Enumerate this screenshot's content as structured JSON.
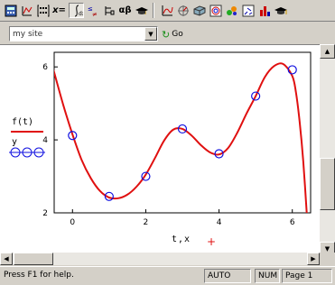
{
  "toolbar": {
    "icons": [
      "calculator-toolbar-icon",
      "graph-toolbar-icon",
      "matrix-toolbar-icon",
      "evaluation-toolbar-icon",
      "calculus-toolbar-icon",
      "boolean-toolbar-icon",
      "programming-toolbar-icon",
      "greek-toolbar-icon",
      "symbolic-toolbar-icon",
      "xy-plot-icon",
      "polar-plot-icon",
      "surface-plot-icon",
      "contour-plot-icon",
      "scatter-3d-icon",
      "vector-field-icon",
      "bar-3d-icon",
      "resources-icon"
    ],
    "eval_label": "x=",
    "greek_label": "αβ"
  },
  "urlbar": {
    "value": "my site",
    "go_label": "Go"
  },
  "legend": {
    "curve_label": "f(t)",
    "points_label": "y",
    "curve_color": "#e01010",
    "points_color": "#1010e0"
  },
  "chart_data": {
    "type": "line",
    "xlabel": "t,x",
    "xlim": [
      -0.5,
      6.5
    ],
    "ylim": [
      2,
      6.4
    ],
    "x_ticks": [
      0,
      2,
      4,
      6
    ],
    "y_ticks": [
      2,
      4,
      6
    ],
    "series": [
      {
        "name": "f(t)",
        "style": "line",
        "color": "#e01010",
        "x": [
          -0.65,
          -0.5,
          -0.25,
          0,
          0.25,
          0.5,
          0.75,
          1,
          1.25,
          1.5,
          1.75,
          2,
          2.25,
          2.5,
          2.75,
          3,
          3.25,
          3.5,
          3.75,
          4,
          4.25,
          4.5,
          4.75,
          5,
          5.25,
          5.5,
          5.75,
          6,
          6.1,
          6.2,
          6.3,
          6.4
        ],
        "y": [
          6.4,
          5.85,
          4.95,
          4.15,
          3.45,
          2.95,
          2.6,
          2.42,
          2.4,
          2.5,
          2.72,
          3.05,
          3.5,
          3.98,
          4.28,
          4.3,
          4.12,
          3.86,
          3.66,
          3.6,
          3.78,
          4.2,
          4.72,
          5.2,
          5.72,
          6.02,
          6.08,
          5.75,
          5.3,
          4.5,
          3.4,
          1.9
        ]
      },
      {
        "name": "y",
        "style": "points",
        "color": "#1010e0",
        "x": [
          0,
          1,
          2,
          3,
          4,
          5,
          6
        ],
        "y": [
          4.12,
          2.45,
          3.0,
          4.3,
          3.62,
          5.2,
          5.92
        ]
      }
    ]
  },
  "status": {
    "help_text": "Press F1 for help.",
    "mode": "AUTO",
    "num": "NUM",
    "page": "Page 1"
  }
}
